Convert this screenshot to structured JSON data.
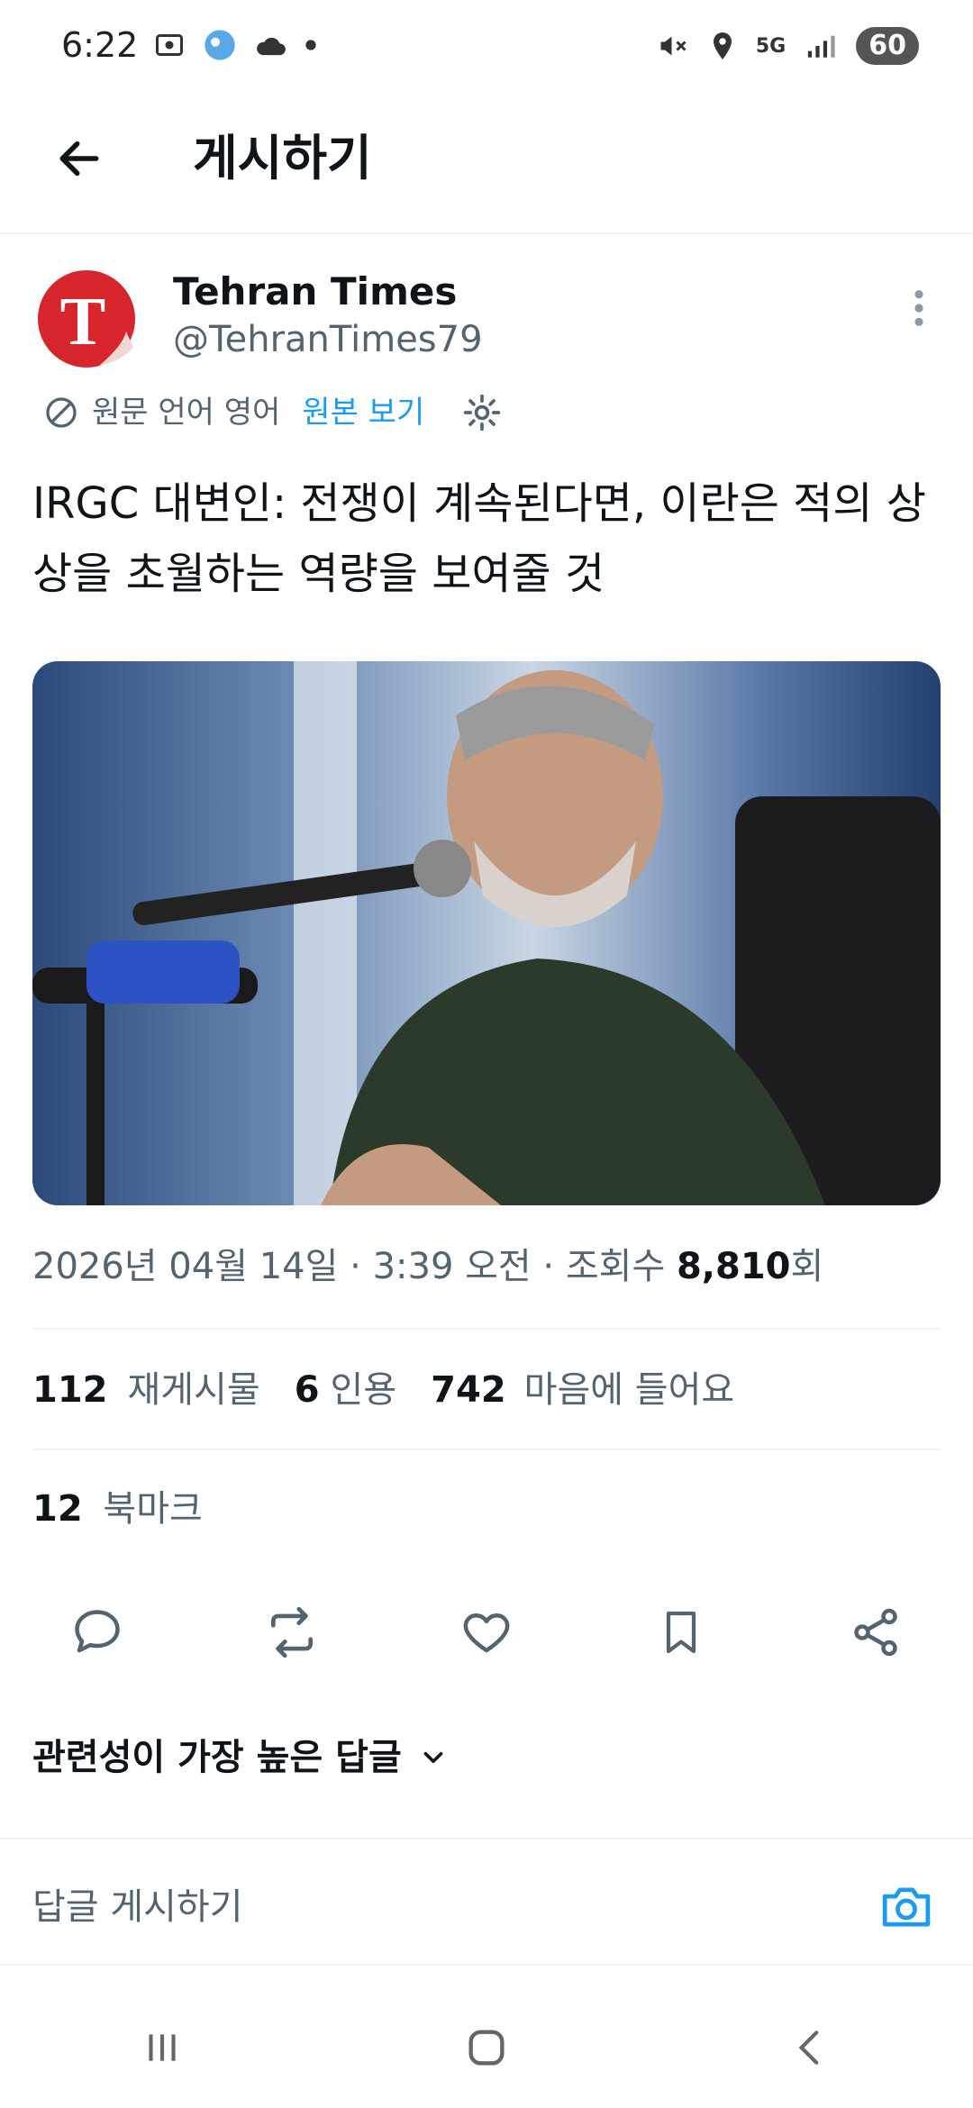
{
  "status_bar": {
    "time": "6:22",
    "network": "5G",
    "battery": "60"
  },
  "header": {
    "title": "게시하기"
  },
  "post": {
    "author_name": "Tehran Times",
    "author_handle": "@TehranTimes79",
    "avatar_letter": "T",
    "translate": {
      "label": "원문 언어 영어",
      "link": "원본 보기"
    },
    "text": "IRGC 대변인: 전쟁이 계속된다면, 이란은 적의 상상을 초월하는 역량을 보여줄 것",
    "meta_prefix": "2026년 04월 14일 · 3:39 오전 · 조회수 ",
    "views": "8,810",
    "views_suffix": "회",
    "stats": {
      "reposts": "112",
      "reposts_label": "재게시물",
      "quotes": "6",
      "quotes_label": "인용",
      "likes": "742",
      "likes_label": "마음에 들어요"
    },
    "bookmarks": "12",
    "bookmarks_label": "북마크"
  },
  "replies": {
    "sort_label": "관련성이 가장 높은 답글",
    "compose_placeholder": "답글 게시하기"
  },
  "colors": {
    "accent": "#1d9bf0",
    "secondary_text": "#536471",
    "avatar_red": "#d7262b"
  }
}
